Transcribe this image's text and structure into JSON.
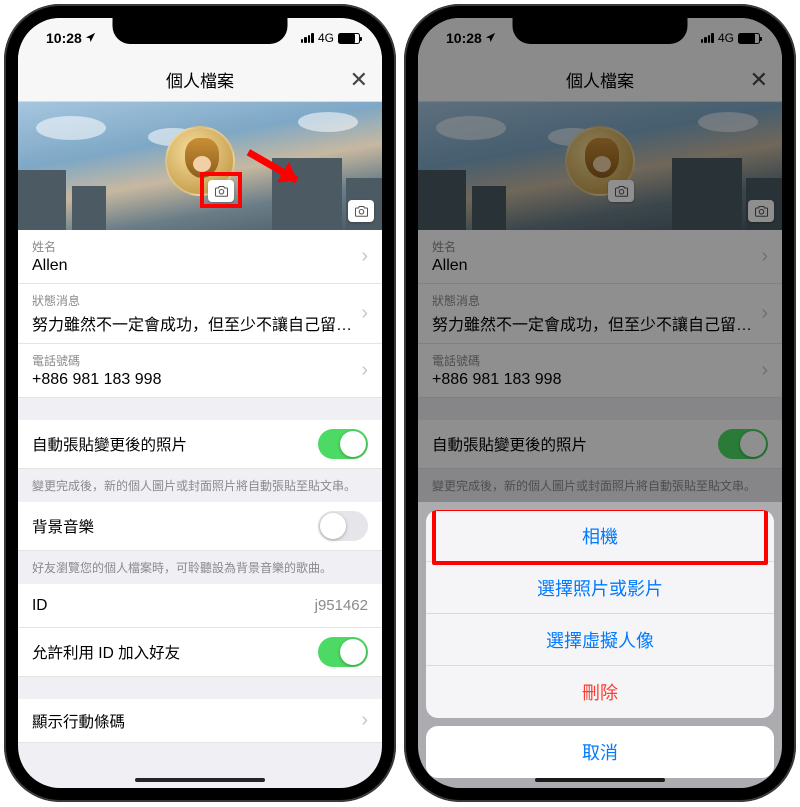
{
  "status": {
    "time": "10:28",
    "network": "4G"
  },
  "nav": {
    "title": "個人檔案",
    "close_glyph": "✕"
  },
  "profile": {
    "name_label": "姓名",
    "name_value": "Allen",
    "status_label": "狀態消息",
    "status_value": "努力雖然不一定會成功，但至少不讓自己留…",
    "phone_label": "電話號碼",
    "phone_value": "+886 981 183 998"
  },
  "auto_post": {
    "title": "自動張貼變更後的照片",
    "hint": "變更完成後，新的個人圖片或封面照片將自動張貼至貼文串。"
  },
  "bgm": {
    "title": "背景音樂",
    "hint": "好友瀏覽您的個人檔案時，可聆聽設為背景音樂的歌曲。"
  },
  "id_section": {
    "id_label": "ID",
    "id_value": "j951462",
    "allow_add_label": "允許利用 ID 加入好友"
  },
  "barcode": {
    "title": "顯示行動條碼"
  },
  "sheet": {
    "camera": "相機",
    "choose": "選擇照片或影片",
    "avatar": "選擇虛擬人像",
    "delete": "刪除",
    "cancel": "取消"
  }
}
